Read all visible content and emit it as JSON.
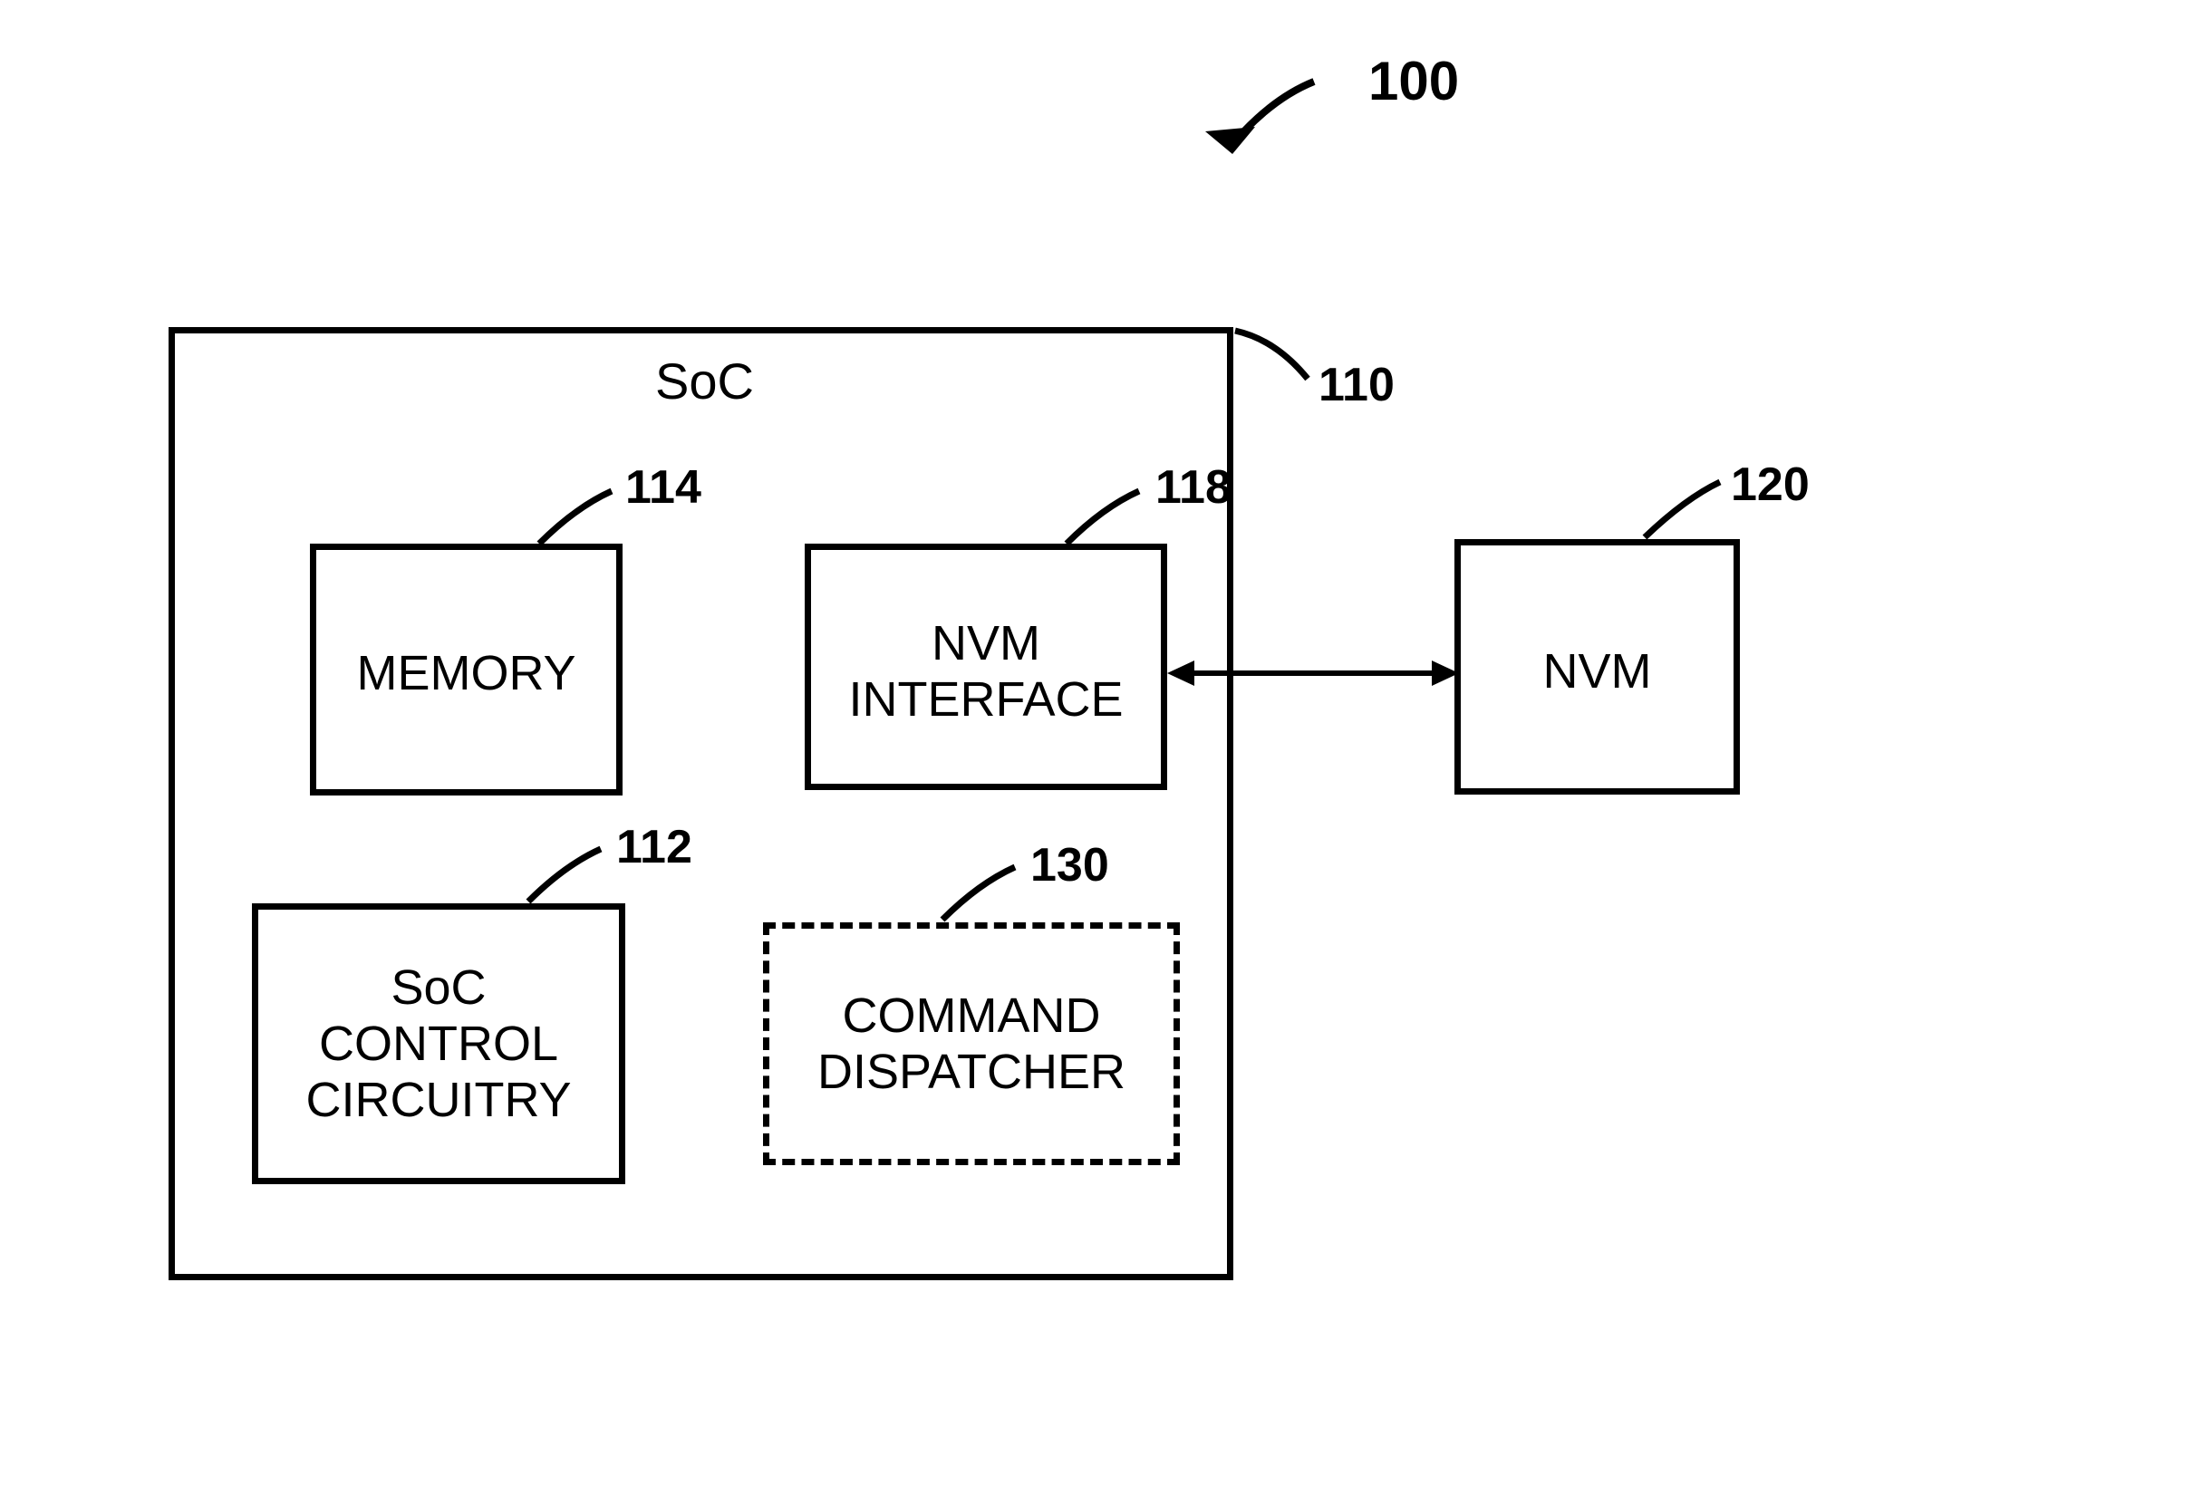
{
  "diagram": {
    "main_ref": "100",
    "soc": {
      "title": "SoC",
      "ref": "110",
      "memory": {
        "label": "MEMORY",
        "ref": "114"
      },
      "nvm_interface": {
        "label_line1": "NVM",
        "label_line2": "INTERFACE",
        "ref": "118"
      },
      "soc_control": {
        "label_line1": "SoC",
        "label_line2": "CONTROL",
        "label_line3": "CIRCUITRY",
        "ref": "112"
      },
      "command_dispatcher": {
        "label_line1": "COMMAND",
        "label_line2": "DISPATCHER",
        "ref": "130"
      }
    },
    "nvm": {
      "label": "NVM",
      "ref": "120"
    }
  }
}
